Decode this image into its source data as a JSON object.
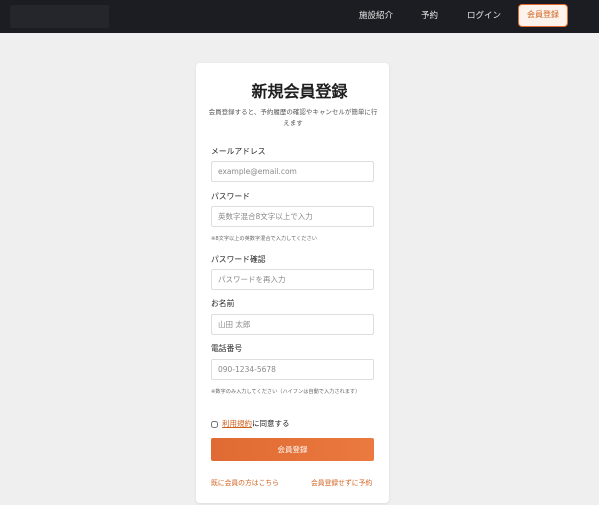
{
  "nav": {
    "links": [
      "施設紹介",
      "予約",
      "ログイン"
    ],
    "cta_label": "会員登録"
  },
  "form": {
    "title": "新規会員登録",
    "subtitle": "会員登録すると、予約履歴の確認やキャンセルが簡単に行えます",
    "email": {
      "label": "メールアドレス",
      "placeholder": "example@email.com"
    },
    "password": {
      "label": "パスワード",
      "placeholder": "英数字混合8文字以上で入力",
      "hint": "※8文字以上の英数字混合で入力してください"
    },
    "password_confirm": {
      "label": "パスワード確認",
      "placeholder": "パスワードを再入力"
    },
    "name": {
      "label": "お名前",
      "placeholder": "山田 太郎"
    },
    "phone": {
      "label": "電話番号",
      "placeholder": "090-1234-5678",
      "hint": "※数字のみ入力してください（ハイフンは自動で入力されます）"
    },
    "agree": {
      "link_text": "利用規約",
      "suffix": "に同意する",
      "checked": false
    },
    "submit_label": "会員登録",
    "footer_links": {
      "login": "既に会員の方はこちら",
      "guest": "会員登録せずに予約"
    }
  },
  "colors": {
    "accent": "#e06a33",
    "header_bg": "#1c1d22",
    "page_bg": "#efeff0"
  }
}
